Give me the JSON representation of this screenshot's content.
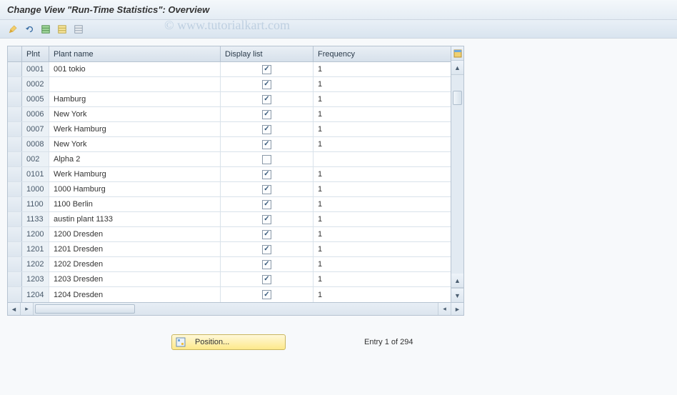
{
  "watermark": "© www.tutorialkart.com",
  "title": "Change View \"Run-Time Statistics\": Overview",
  "toolbar": {
    "icons": [
      "pencil-yellow-icon",
      "undo-blue-icon",
      "table-green-icon",
      "table-yellow-icon",
      "table-grey-icon"
    ]
  },
  "table": {
    "columns": {
      "plnt": "Plnt",
      "name": "Plant name",
      "display": "Display list",
      "freq": "Frequency"
    },
    "rows": [
      {
        "plnt": "0001",
        "name": "001 tokio",
        "display": true,
        "freq": "1"
      },
      {
        "plnt": "0002",
        "name": "",
        "display": true,
        "freq": "1"
      },
      {
        "plnt": "0005",
        "name": "Hamburg",
        "display": true,
        "freq": "1"
      },
      {
        "plnt": "0006",
        "name": "New York",
        "display": true,
        "freq": "1"
      },
      {
        "plnt": "0007",
        "name": "Werk Hamburg",
        "display": true,
        "freq": "1"
      },
      {
        "plnt": "0008",
        "name": "New York",
        "display": true,
        "freq": "1"
      },
      {
        "plnt": "002",
        "name": "Alpha 2",
        "display": false,
        "freq": ""
      },
      {
        "plnt": "0101",
        "name": "Werk Hamburg",
        "display": true,
        "freq": "1"
      },
      {
        "plnt": "1000",
        "name": "1000 Hamburg",
        "display": true,
        "freq": "1"
      },
      {
        "plnt": "1100",
        "name": "1100 Berlin",
        "display": true,
        "freq": "1"
      },
      {
        "plnt": "1133",
        "name": "austin plant 1133",
        "display": true,
        "freq": "1"
      },
      {
        "plnt": "1200",
        "name": "1200 Dresden",
        "display": true,
        "freq": "1"
      },
      {
        "plnt": "1201",
        "name": "1201 Dresden",
        "display": true,
        "freq": "1"
      },
      {
        "plnt": "1202",
        "name": "1202 Dresden",
        "display": true,
        "freq": "1"
      },
      {
        "plnt": "1203",
        "name": "1203 Dresden",
        "display": true,
        "freq": "1"
      },
      {
        "plnt": "1204",
        "name": "1204 Dresden",
        "display": true,
        "freq": "1"
      }
    ]
  },
  "footer": {
    "position_label": "Position...",
    "entry_text": "Entry 1 of 294"
  }
}
